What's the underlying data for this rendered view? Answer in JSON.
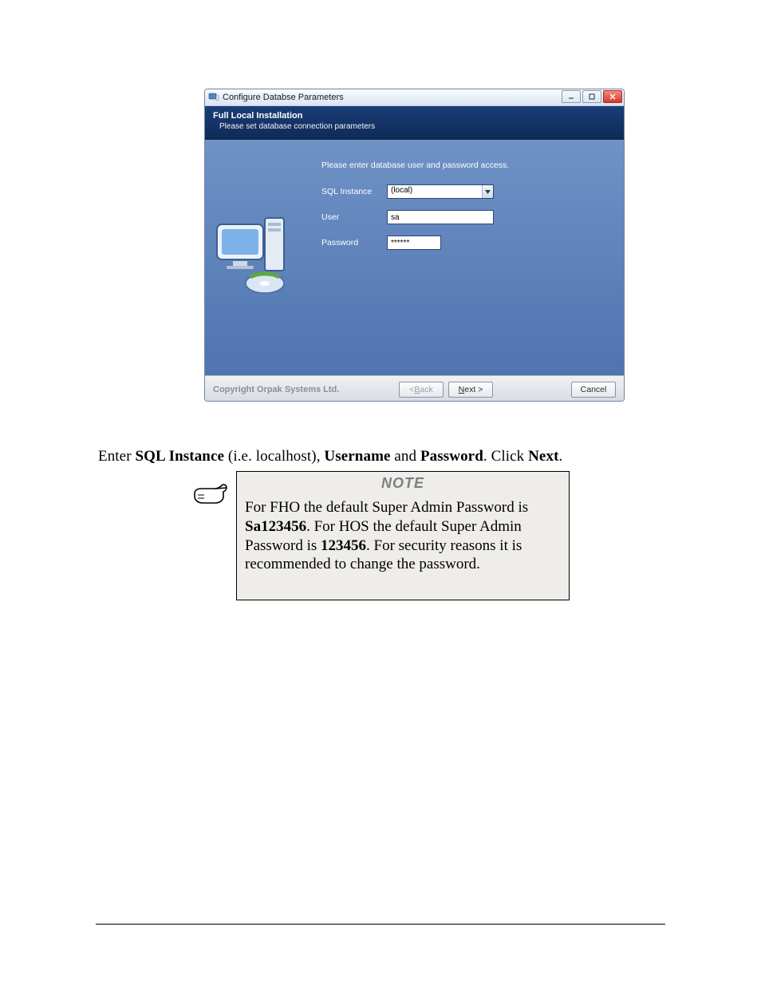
{
  "window": {
    "title": "Configure Databse Parameters",
    "header": {
      "heading": "Full Local Installation",
      "subheading": "Please set database connection parameters"
    },
    "form": {
      "instruction": "Please enter database user and password access.",
      "sql_instance_label": "SQL Instance",
      "sql_instance_value": "(local)",
      "user_label": "User",
      "user_value": "sa",
      "password_label": "Password",
      "password_value": "******"
    },
    "footer": {
      "copyright": "Copyright Orpak Systems Ltd.",
      "back_prefix": "< ",
      "back_mn": "B",
      "back_suffix": "ack",
      "next_mn": "N",
      "next_suffix": "ext >",
      "cancel": "Cancel"
    }
  },
  "instruction_text": {
    "pre1": "Enter ",
    "b1": "SQL Instance",
    "mid1": " (i.e. localhost), ",
    "b2": "Username",
    "mid2": " and ",
    "b3": "Password",
    "mid3": ". Click ",
    "b4": "Next",
    "end": "."
  },
  "note": {
    "title": "NOTE",
    "line1_pre": "For FHO the default Super Admin Password is ",
    "line1_bold": "Sa123456",
    "line1_post": ". For HOS the default Super Admin Password is ",
    "line2_bold": "123456",
    "line2_post": ". For security reasons it is recommended to change the password."
  }
}
